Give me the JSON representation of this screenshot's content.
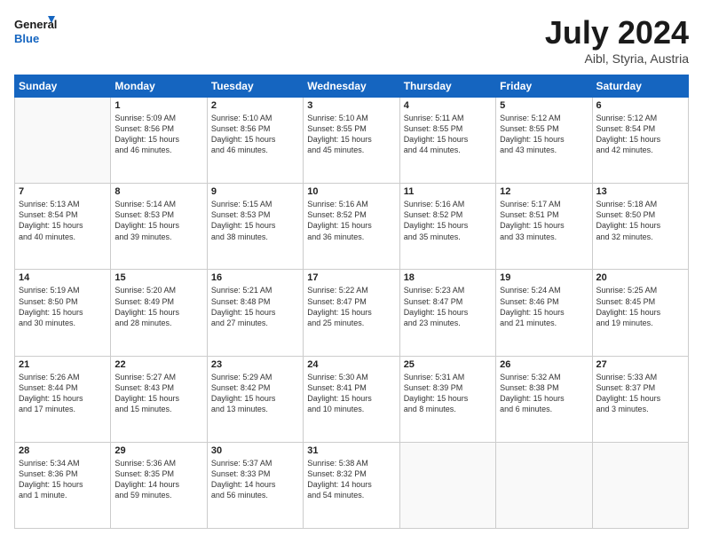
{
  "logo": {
    "line1": "General",
    "line2": "Blue"
  },
  "title": "July 2024",
  "subtitle": "Aibl, Styria, Austria",
  "headers": [
    "Sunday",
    "Monday",
    "Tuesday",
    "Wednesday",
    "Thursday",
    "Friday",
    "Saturday"
  ],
  "weeks": [
    [
      {
        "day": "",
        "info": ""
      },
      {
        "day": "1",
        "info": "Sunrise: 5:09 AM\nSunset: 8:56 PM\nDaylight: 15 hours\nand 46 minutes."
      },
      {
        "day": "2",
        "info": "Sunrise: 5:10 AM\nSunset: 8:56 PM\nDaylight: 15 hours\nand 46 minutes."
      },
      {
        "day": "3",
        "info": "Sunrise: 5:10 AM\nSunset: 8:55 PM\nDaylight: 15 hours\nand 45 minutes."
      },
      {
        "day": "4",
        "info": "Sunrise: 5:11 AM\nSunset: 8:55 PM\nDaylight: 15 hours\nand 44 minutes."
      },
      {
        "day": "5",
        "info": "Sunrise: 5:12 AM\nSunset: 8:55 PM\nDaylight: 15 hours\nand 43 minutes."
      },
      {
        "day": "6",
        "info": "Sunrise: 5:12 AM\nSunset: 8:54 PM\nDaylight: 15 hours\nand 42 minutes."
      }
    ],
    [
      {
        "day": "7",
        "info": "Sunrise: 5:13 AM\nSunset: 8:54 PM\nDaylight: 15 hours\nand 40 minutes."
      },
      {
        "day": "8",
        "info": "Sunrise: 5:14 AM\nSunset: 8:53 PM\nDaylight: 15 hours\nand 39 minutes."
      },
      {
        "day": "9",
        "info": "Sunrise: 5:15 AM\nSunset: 8:53 PM\nDaylight: 15 hours\nand 38 minutes."
      },
      {
        "day": "10",
        "info": "Sunrise: 5:16 AM\nSunset: 8:52 PM\nDaylight: 15 hours\nand 36 minutes."
      },
      {
        "day": "11",
        "info": "Sunrise: 5:16 AM\nSunset: 8:52 PM\nDaylight: 15 hours\nand 35 minutes."
      },
      {
        "day": "12",
        "info": "Sunrise: 5:17 AM\nSunset: 8:51 PM\nDaylight: 15 hours\nand 33 minutes."
      },
      {
        "day": "13",
        "info": "Sunrise: 5:18 AM\nSunset: 8:50 PM\nDaylight: 15 hours\nand 32 minutes."
      }
    ],
    [
      {
        "day": "14",
        "info": "Sunrise: 5:19 AM\nSunset: 8:50 PM\nDaylight: 15 hours\nand 30 minutes."
      },
      {
        "day": "15",
        "info": "Sunrise: 5:20 AM\nSunset: 8:49 PM\nDaylight: 15 hours\nand 28 minutes."
      },
      {
        "day": "16",
        "info": "Sunrise: 5:21 AM\nSunset: 8:48 PM\nDaylight: 15 hours\nand 27 minutes."
      },
      {
        "day": "17",
        "info": "Sunrise: 5:22 AM\nSunset: 8:47 PM\nDaylight: 15 hours\nand 25 minutes."
      },
      {
        "day": "18",
        "info": "Sunrise: 5:23 AM\nSunset: 8:47 PM\nDaylight: 15 hours\nand 23 minutes."
      },
      {
        "day": "19",
        "info": "Sunrise: 5:24 AM\nSunset: 8:46 PM\nDaylight: 15 hours\nand 21 minutes."
      },
      {
        "day": "20",
        "info": "Sunrise: 5:25 AM\nSunset: 8:45 PM\nDaylight: 15 hours\nand 19 minutes."
      }
    ],
    [
      {
        "day": "21",
        "info": "Sunrise: 5:26 AM\nSunset: 8:44 PM\nDaylight: 15 hours\nand 17 minutes."
      },
      {
        "day": "22",
        "info": "Sunrise: 5:27 AM\nSunset: 8:43 PM\nDaylight: 15 hours\nand 15 minutes."
      },
      {
        "day": "23",
        "info": "Sunrise: 5:29 AM\nSunset: 8:42 PM\nDaylight: 15 hours\nand 13 minutes."
      },
      {
        "day": "24",
        "info": "Sunrise: 5:30 AM\nSunset: 8:41 PM\nDaylight: 15 hours\nand 10 minutes."
      },
      {
        "day": "25",
        "info": "Sunrise: 5:31 AM\nSunset: 8:39 PM\nDaylight: 15 hours\nand 8 minutes."
      },
      {
        "day": "26",
        "info": "Sunrise: 5:32 AM\nSunset: 8:38 PM\nDaylight: 15 hours\nand 6 minutes."
      },
      {
        "day": "27",
        "info": "Sunrise: 5:33 AM\nSunset: 8:37 PM\nDaylight: 15 hours\nand 3 minutes."
      }
    ],
    [
      {
        "day": "28",
        "info": "Sunrise: 5:34 AM\nSunset: 8:36 PM\nDaylight: 15 hours\nand 1 minute."
      },
      {
        "day": "29",
        "info": "Sunrise: 5:36 AM\nSunset: 8:35 PM\nDaylight: 14 hours\nand 59 minutes."
      },
      {
        "day": "30",
        "info": "Sunrise: 5:37 AM\nSunset: 8:33 PM\nDaylight: 14 hours\nand 56 minutes."
      },
      {
        "day": "31",
        "info": "Sunrise: 5:38 AM\nSunset: 8:32 PM\nDaylight: 14 hours\nand 54 minutes."
      },
      {
        "day": "",
        "info": ""
      },
      {
        "day": "",
        "info": ""
      },
      {
        "day": "",
        "info": ""
      }
    ]
  ]
}
